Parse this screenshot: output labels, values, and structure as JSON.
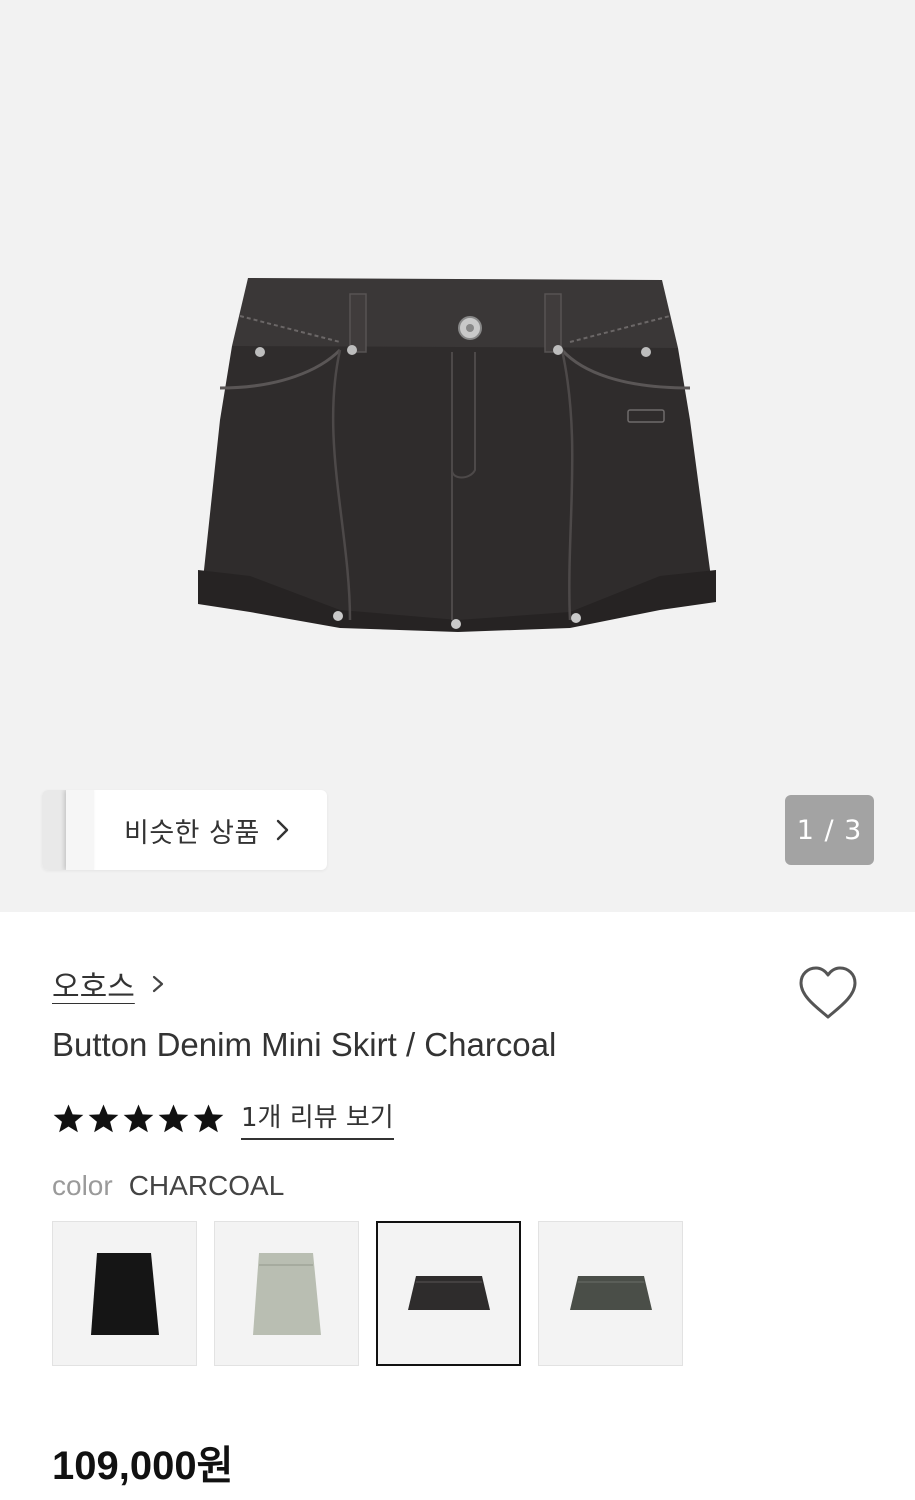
{
  "gallery": {
    "similar_label": "비슷한 상품",
    "page_counter": "1 / 3",
    "product_image": "denim-mini-skirt-image"
  },
  "product": {
    "brand": "오호스",
    "title": "Button Denim Mini Skirt / Charcoal",
    "rating": 5,
    "review_link": "1개 리뷰 보기",
    "color_label": "color",
    "color_value": "CHARCOAL",
    "color_options": [
      {
        "name": "black",
        "swatch": "#151515",
        "selected": false
      },
      {
        "name": "light-grey",
        "swatch": "#b9beb2",
        "selected": false
      },
      {
        "name": "charcoal",
        "swatch": "#2e2c2c",
        "selected": true
      },
      {
        "name": "khaki",
        "swatch": "#4a4e48",
        "selected": false
      }
    ],
    "price": "109,000원"
  },
  "colors": {
    "hero_bg": "#f2f2f2",
    "counter_bg": "#a3a3a3",
    "text": "#333333",
    "muted": "#9a9a9a"
  },
  "icons": [
    "chevron-right-icon",
    "heart-icon",
    "star-icon"
  ]
}
